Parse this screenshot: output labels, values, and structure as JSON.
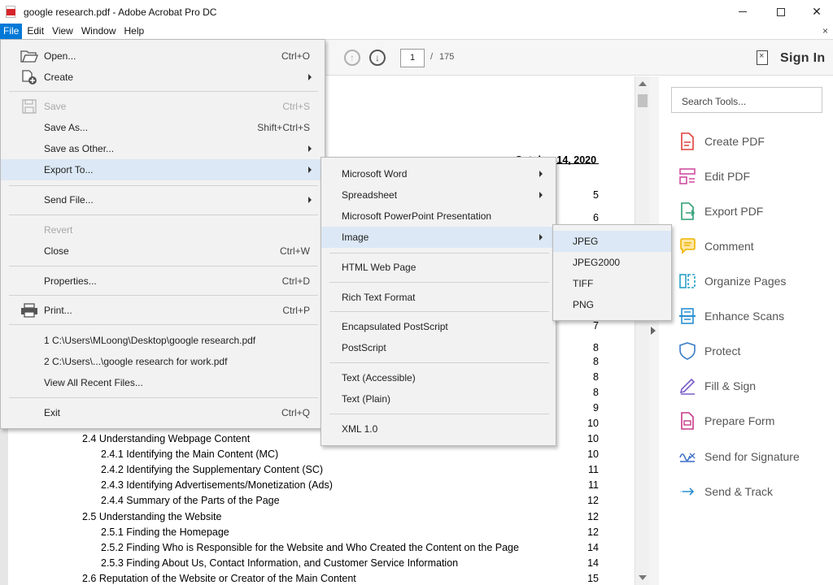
{
  "window": {
    "title": "google research.pdf - Adobe Acrobat Pro DC",
    "minimize_label": "—",
    "close_label": "✕"
  },
  "menubar": {
    "items": [
      "File",
      "Edit",
      "View",
      "Window",
      "Help"
    ],
    "doc_close": "×"
  },
  "toolbar": {
    "page_current": "1",
    "page_separator": "/",
    "page_total": "175",
    "sign_in": "Sign In"
  },
  "file_menu": {
    "items": [
      {
        "label": "Open...",
        "shortcut": "Ctrl+O"
      },
      {
        "label": "Create",
        "shortcut": ""
      },
      {
        "label": "Save",
        "shortcut": "Ctrl+S"
      },
      {
        "label": "Save As...",
        "shortcut": "Shift+Ctrl+S"
      },
      {
        "label": "Save as Other...",
        "shortcut": ""
      },
      {
        "label": "Export To...",
        "shortcut": ""
      },
      {
        "label": "Send File...",
        "shortcut": ""
      },
      {
        "label": "Revert",
        "shortcut": ""
      },
      {
        "label": "Close",
        "shortcut": "Ctrl+W"
      },
      {
        "label": "Properties...",
        "shortcut": "Ctrl+D"
      },
      {
        "label": "Print...",
        "shortcut": "Ctrl+P"
      },
      {
        "label": "1 C:\\Users\\MLoong\\Desktop\\google research.pdf",
        "shortcut": ""
      },
      {
        "label": "2 C:\\Users\\...\\google research for work.pdf",
        "shortcut": ""
      },
      {
        "label": "View All Recent Files...",
        "shortcut": ""
      },
      {
        "label": "Exit",
        "shortcut": "Ctrl+Q"
      }
    ]
  },
  "export_menu": {
    "items": [
      "Microsoft Word",
      "Spreadsheet",
      "Microsoft PowerPoint Presentation",
      "Image",
      "HTML Web Page",
      "Rich Text Format",
      "Encapsulated PostScript",
      "PostScript",
      "Text (Accessible)",
      "Text (Plain)",
      "XML 1.0"
    ]
  },
  "image_menu": {
    "items": [
      "JPEG",
      "JPEG2000",
      "TIFF",
      "PNG"
    ]
  },
  "document": {
    "date": "October 14, 2020",
    "page_numbers_right": [
      "5",
      "6",
      "7",
      "8",
      "8",
      "8",
      "8",
      "9",
      "10"
    ],
    "toc": [
      {
        "text": "2.4 Understanding Webpage Content",
        "page": "10",
        "indent": 1
      },
      {
        "text": "2.4.1 Identifying the Main Content (MC)",
        "page": "10",
        "indent": 2
      },
      {
        "text": "2.4.2 Identifying the Supplementary Content (SC)",
        "page": "11",
        "indent": 2
      },
      {
        "text": "2.4.3 Identifying Advertisements/Monetization (Ads)",
        "page": "11",
        "indent": 2
      },
      {
        "text": "2.4.4 Summary of the Parts of the Page",
        "page": "12",
        "indent": 2
      },
      {
        "text": "2.5 Understanding the Website",
        "page": "12",
        "indent": 1
      },
      {
        "text": "2.5.1 Finding the Homepage",
        "page": "12",
        "indent": 2
      },
      {
        "text": "2.5.2 Finding Who is Responsible for the Website and Who Created the Content on the Page",
        "page": "14",
        "indent": 2
      },
      {
        "text": "2.5.3 Finding About Us, Contact Information, and Customer Service Information",
        "page": "14",
        "indent": 2
      },
      {
        "text": "2.6 Reputation of the Website or Creator of the Main Content",
        "page": "15",
        "indent": 1
      }
    ]
  },
  "tools": {
    "search_placeholder": "Search Tools...",
    "items": [
      {
        "label": "Create PDF",
        "icon": "create-pdf-icon",
        "color": "#e0403c"
      },
      {
        "label": "Edit PDF",
        "icon": "edit-pdf-icon",
        "color": "#d04fa0"
      },
      {
        "label": "Export PDF",
        "icon": "export-pdf-icon",
        "color": "#2f9e74"
      },
      {
        "label": "Comment",
        "icon": "comment-icon",
        "color": "#f0b400"
      },
      {
        "label": "Organize Pages",
        "icon": "organize-pages-icon",
        "color": "#2aa0c8"
      },
      {
        "label": "Enhance Scans",
        "icon": "enhance-scans-icon",
        "color": "#2a8fd0"
      },
      {
        "label": "Protect",
        "icon": "protect-icon",
        "color": "#3a7cc8"
      },
      {
        "label": "Fill & Sign",
        "icon": "fill-sign-icon",
        "color": "#7a5cc8"
      },
      {
        "label": "Prepare Form",
        "icon": "prepare-form-icon",
        "color": "#c83a8a"
      },
      {
        "label": "Send for Signature",
        "icon": "send-signature-icon",
        "color": "#3a6cc8"
      },
      {
        "label": "Send & Track",
        "icon": "send-track-icon",
        "color": "#2a8fd0"
      }
    ]
  }
}
